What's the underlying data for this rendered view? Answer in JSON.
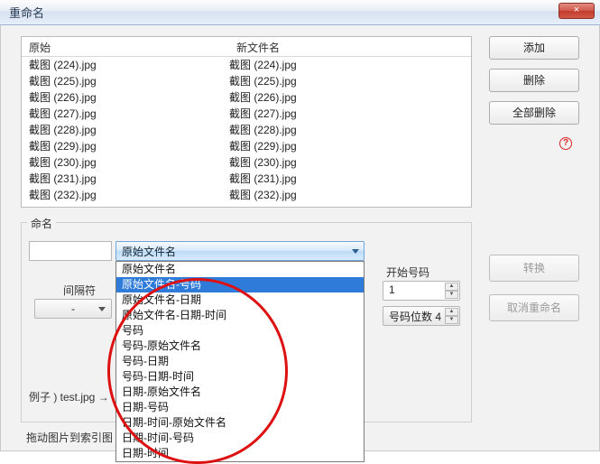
{
  "titlebar": {
    "title": "重命名",
    "close": "×"
  },
  "buttons": {
    "add": "添加",
    "delete": "删除",
    "delete_all": "全部删除",
    "convert": "转换",
    "cancel_rename": "取消重命名",
    "help": "?"
  },
  "file_table": {
    "header_orig": "原始",
    "header_new": "新文件名",
    "rows": [
      {
        "orig": "截图 (224).jpg",
        "new": "截图 (224).jpg"
      },
      {
        "orig": "截图 (225).jpg",
        "new": "截图 (225).jpg"
      },
      {
        "orig": "截图 (226).jpg",
        "new": "截图 (226).jpg"
      },
      {
        "orig": "截图 (227).jpg",
        "new": "截图 (227).jpg"
      },
      {
        "orig": "截图 (228).jpg",
        "new": "截图 (228).jpg"
      },
      {
        "orig": "截图 (229).jpg",
        "new": "截图 (229).jpg"
      },
      {
        "orig": "截图 (230).jpg",
        "new": "截图 (230).jpg"
      },
      {
        "orig": "截图 (231).jpg",
        "new": "截图 (231).jpg"
      },
      {
        "orig": "截图 (232).jpg",
        "new": "截图 (232).jpg"
      }
    ]
  },
  "naming": {
    "group_label": "命名",
    "template_selected": "原始文件名",
    "template_options": [
      "原始文件名",
      "原始文件名-号码",
      "原始文件名-日期",
      "原始文件名-日期-时间",
      "号码",
      "号码-原始文件名",
      "号码-日期",
      "号码-日期-时间",
      "日期-原始文件名",
      "日期-号码",
      "日期-时间-原始文件名",
      "日期-时间-号码",
      "日期-时间"
    ],
    "template_highlight_index": 1,
    "separator_label": "间隔符",
    "separator_value": "-",
    "start_label": "开始号码",
    "start_value": "1",
    "digits_label": "号码位数 4",
    "example_label": "例子 ) test.jpg →"
  },
  "footer": {
    "drag_hint": "拖动图片到索引图"
  }
}
